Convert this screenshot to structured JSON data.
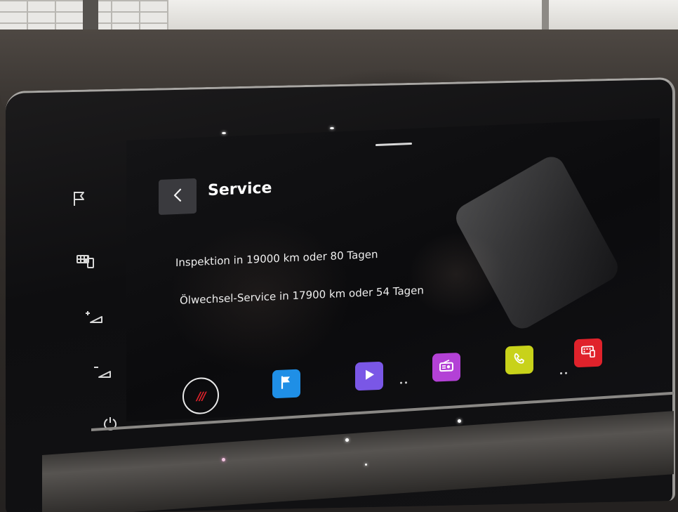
{
  "header": {
    "title": "Service",
    "back_icon": "chevron-left-icon"
  },
  "messages": [
    "Inspektion in 19000 km oder 80 Tagen",
    "Ölwechsel-Service in 17900 km oder 54 Tagen"
  ],
  "side_keys": [
    {
      "name": "navigation-key",
      "icon": "flag-icon"
    },
    {
      "name": "menu-key",
      "icon": "grid-menu-icon"
    },
    {
      "name": "volume-up-key",
      "icon": "volume-up-icon"
    },
    {
      "name": "volume-down-key",
      "icon": "volume-down-icon"
    },
    {
      "name": "power-key",
      "icon": "power-icon"
    }
  ],
  "dock": {
    "home_icon": "home-logo-icon",
    "home_label": "///",
    "apps": [
      {
        "name": "navigation",
        "icon": "flag-icon",
        "color": "#1f8fe6"
      },
      {
        "name": "media",
        "icon": "play-icon",
        "color": "#7a57e6"
      },
      {
        "name": "radio",
        "icon": "radio-icon",
        "color": "#b341d6"
      },
      {
        "name": "phone",
        "icon": "phone-icon",
        "color": "#c8d21a"
      },
      {
        "name": "car-settings",
        "icon": "car-menu-icon",
        "color": "#e0222b"
      }
    ]
  },
  "colors": {
    "screen_background": "#0d0d10",
    "text": "#eeeeee",
    "back_button": "#3a3a3e",
    "home_accent": "#e0222b"
  }
}
